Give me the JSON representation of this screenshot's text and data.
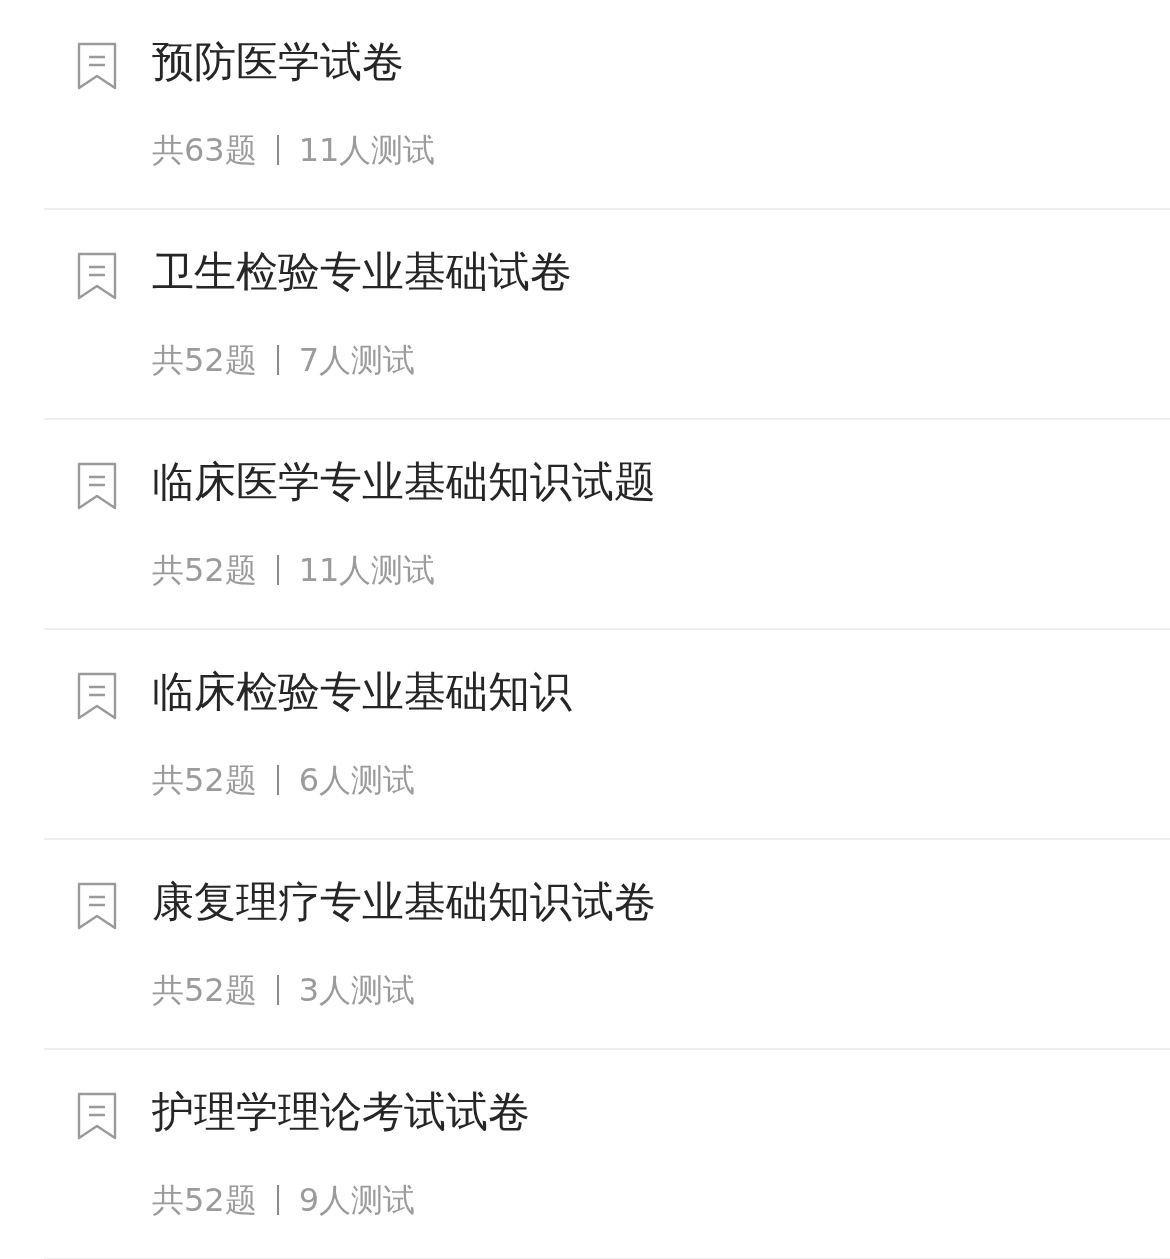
{
  "papers": [
    {
      "title": "预防医学试卷",
      "question_count": "共63题",
      "testers": "11人测试"
    },
    {
      "title": "卫生检验专业基础试卷",
      "question_count": "共52题",
      "testers": "7人测试"
    },
    {
      "title": "临床医学专业基础知识试题",
      "question_count": "共52题",
      "testers": "11人测试"
    },
    {
      "title": "临床检验专业基础知识",
      "question_count": "共52题",
      "testers": "6人测试"
    },
    {
      "title": "康复理疗专业基础知识试卷",
      "question_count": "共52题",
      "testers": "3人测试"
    },
    {
      "title": "护理学理论考试试卷",
      "question_count": "共52题",
      "testers": "9人测试"
    }
  ]
}
